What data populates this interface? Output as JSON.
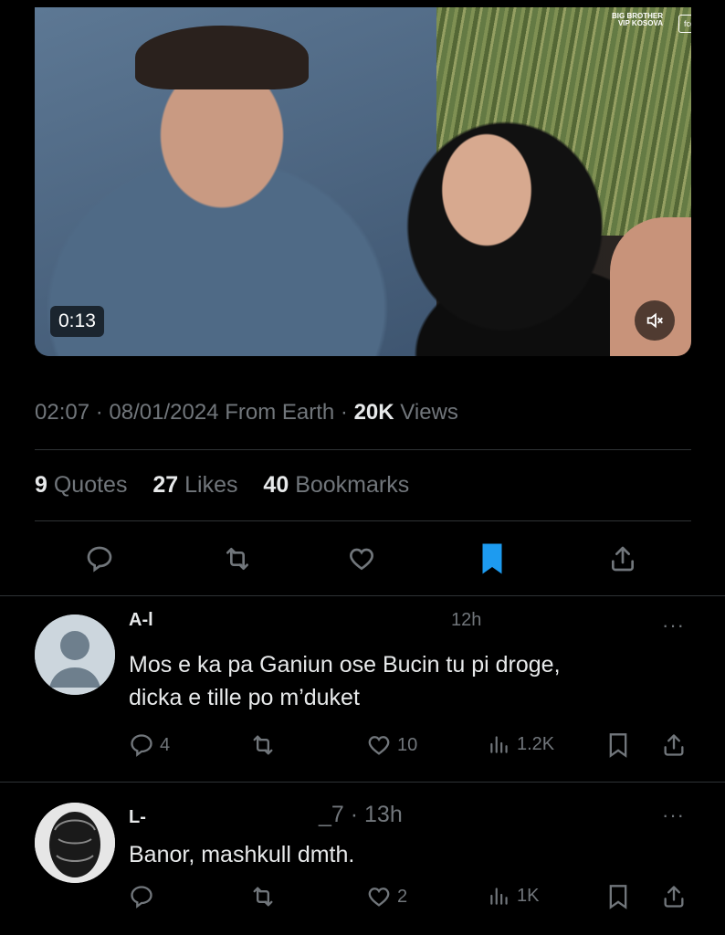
{
  "video": {
    "timecode": "0:13",
    "watermark_line1": "BIG BROTHER",
    "watermark_line2": "VIP KOSOVA",
    "watermark_badge": "fcg",
    "mute_icon": "speaker-muted-icon"
  },
  "post_meta": {
    "time": "02:07",
    "date": "08/01/2024",
    "source": "From Earth",
    "views_count": "20K",
    "views_label": "Views"
  },
  "stats": {
    "quotes_count": "9",
    "quotes_label": "Quotes",
    "likes_count": "27",
    "likes_label": "Likes",
    "bookmarks_count": "40",
    "bookmarks_label": "Bookmarks"
  },
  "actions": {
    "reply_icon": "reply-icon",
    "retweet_icon": "retweet-icon",
    "like_icon": "heart-icon",
    "bookmark_icon": "bookmark-filled-icon",
    "share_icon": "share-icon",
    "accent_color": "#1d9bf0"
  },
  "replies": [
    {
      "name": "A-l",
      "time_fragment": "12h",
      "text_line1": "Mos e ka pa Ganiun ose Bucin tu pi droge,",
      "text_line2": "dicka e tille po m’duket",
      "reply_count": "4",
      "like_count": "10",
      "views_count": "1.2K"
    },
    {
      "name": "L-",
      "handle_time": "_7 · 13h",
      "text_line1": "Banor, mashkull dmth.",
      "reply_count": "",
      "like_count": "2",
      "views_count": "1K"
    }
  ],
  "more_label": "···"
}
